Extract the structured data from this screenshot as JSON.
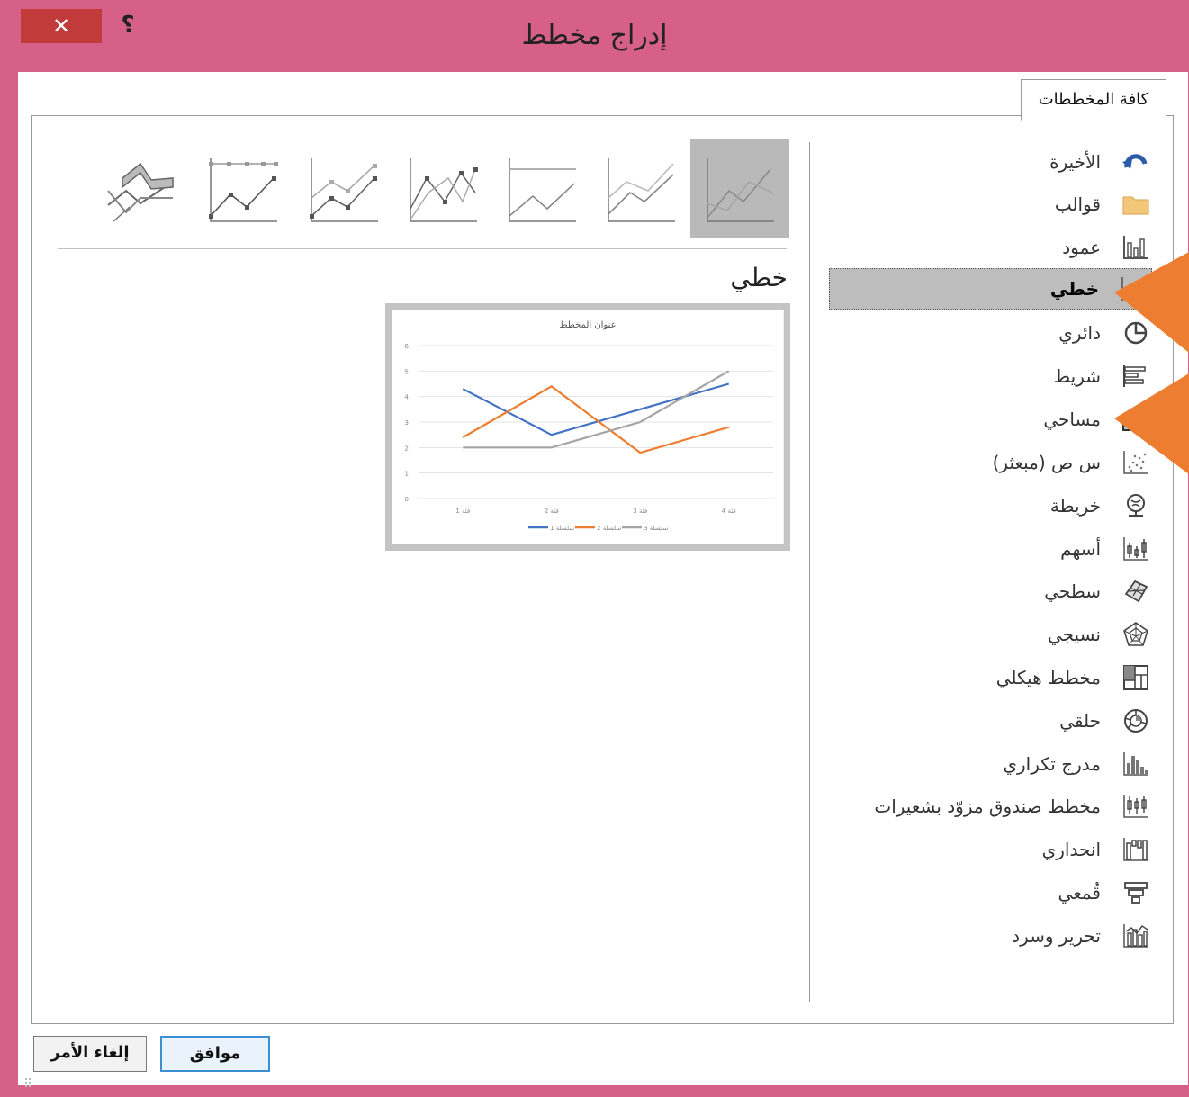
{
  "window": {
    "title": "إدراج مخطط",
    "close_symbol": "✕",
    "help_symbol": "؟"
  },
  "tab": {
    "label": "كافة المخططات"
  },
  "categories": [
    {
      "label": "الأخيرة",
      "icon": "recent-icon"
    },
    {
      "label": "قوالب",
      "icon": "templates-folder-icon"
    },
    {
      "label": "عمود",
      "icon": "column-chart-icon"
    },
    {
      "label": "خطي",
      "icon": "line-chart-icon",
      "selected": true
    },
    {
      "label": "دائري",
      "icon": "pie-chart-icon"
    },
    {
      "label": "شريط",
      "icon": "bar-chart-icon"
    },
    {
      "label": "مساحي",
      "icon": "area-chart-icon"
    },
    {
      "label": "س ص (مبعثر)",
      "icon": "scatter-chart-icon"
    },
    {
      "label": "خريطة",
      "icon": "map-chart-icon"
    },
    {
      "label": "أسهم",
      "icon": "stock-chart-icon"
    },
    {
      "label": "سطحي",
      "icon": "surface-chart-icon"
    },
    {
      "label": "نسيجي",
      "icon": "radar-chart-icon"
    },
    {
      "label": "مخطط هيكلي",
      "icon": "treemap-chart-icon"
    },
    {
      "label": "حلقي",
      "icon": "sunburst-chart-icon"
    },
    {
      "label": "مدرج تكراري",
      "icon": "histogram-chart-icon"
    },
    {
      "label": "مخطط صندوق مزوّد بشعيرات",
      "icon": "box-whisker-chart-icon"
    },
    {
      "label": "انحداري",
      "icon": "waterfall-chart-icon"
    },
    {
      "label": "قُمعي",
      "icon": "funnel-chart-icon"
    },
    {
      "label": "تحرير وسرد",
      "icon": "combo-chart-icon"
    }
  ],
  "subtypes": [
    {
      "name": "line",
      "selected": true
    },
    {
      "name": "stacked-line"
    },
    {
      "name": "100-stacked-line"
    },
    {
      "name": "line-with-markers"
    },
    {
      "name": "stacked-line-with-markers"
    },
    {
      "name": "100-stacked-line-with-markers"
    },
    {
      "name": "3d-line"
    }
  ],
  "section_title": "خطي",
  "chart_data": {
    "type": "line",
    "title": "عنوان المخطط",
    "categories": [
      "فئة 1",
      "فئة 2",
      "فئة 3",
      "فئة 4"
    ],
    "ylim": [
      0,
      6
    ],
    "yticks": [
      "0",
      "1",
      "2",
      "3",
      "4",
      "5",
      "6"
    ],
    "grid": true,
    "legend": "bottom",
    "series": [
      {
        "name": "سلسلة 1",
        "values": [
          4.3,
          2.5,
          3.5,
          4.5
        ],
        "color": "#4472c4"
      },
      {
        "name": "سلسلة 2",
        "values": [
          2.4,
          4.4,
          1.8,
          2.8
        ],
        "color": "#ed7d31"
      },
      {
        "name": "سلسلة 3",
        "values": [
          2,
          2,
          3,
          5
        ],
        "color": "#a5a5a5"
      }
    ]
  },
  "buttons": {
    "ok": "موافق",
    "cancel": "إلغاء الأمر"
  },
  "colors": {
    "titlebar": "#d66088",
    "close": "#c23b3b",
    "callout": "#ed7d31",
    "selection": "#bdbdbd"
  }
}
